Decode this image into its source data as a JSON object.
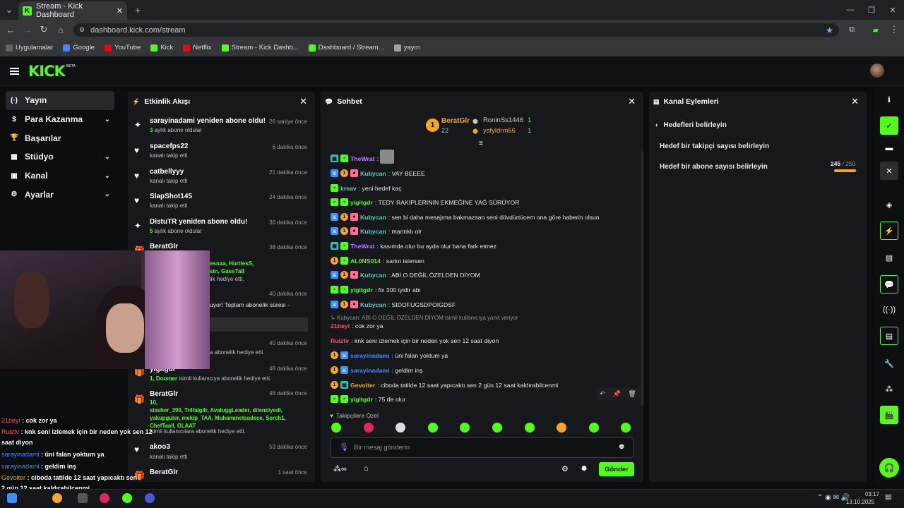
{
  "browser": {
    "tab_title": "Stream - Kick Dashboard",
    "url": "dashboard.kick.com/stream",
    "bookmarks": [
      "Uygulamalar",
      "Google",
      "YouTube",
      "Kick",
      "Netflix",
      "Stream - Kick Dashb...",
      "Dashboard / Stream...",
      "yayın"
    ],
    "bookmark_colors": [
      "#5f6368",
      "#4285f4",
      "#ff0000",
      "#53fc18",
      "#e50914",
      "#53fc18",
      "#53fc18",
      "#9aa0a6"
    ]
  },
  "header": {
    "logo": "KICK",
    "beta": "BETA"
  },
  "nav": {
    "items": [
      {
        "label": "Yayın",
        "icon": "broadcast-icon",
        "active": true,
        "chevron": false
      },
      {
        "label": "Para Kazanma",
        "icon": "money-icon",
        "active": false,
        "chevron": true
      },
      {
        "label": "Başarılar",
        "icon": "trophy-icon",
        "active": false,
        "chevron": false
      },
      {
        "label": "Stüdyo",
        "icon": "studio-icon",
        "active": false,
        "chevron": true
      },
      {
        "label": "Kanal",
        "icon": "channel-icon",
        "active": false,
        "chevron": true
      },
      {
        "label": "Ayarlar",
        "icon": "settings-icon",
        "active": false,
        "chevron": true
      }
    ]
  },
  "activity": {
    "title": "Etkinlik Akışı",
    "items": [
      {
        "name": "sarayinadami yeniden abone oldu!",
        "sub_num": "3",
        "sub": " aylık abone oldular",
        "time": "26 saniye önce",
        "icon": "star-icon"
      },
      {
        "name": "spacefps22",
        "sub_num": "",
        "sub": "kanalı takip etti",
        "time": "6 dakika önce",
        "icon": "heart-icon"
      },
      {
        "name": "catbellyyy",
        "sub_num": "",
        "sub": "kanalı takip etti",
        "time": "21 dakika önce",
        "icon": "heart-icon"
      },
      {
        "name": "SlapShot145",
        "sub_num": "",
        "sub": "kanalı takip etti",
        "time": "24 dakika önce",
        "icon": "heart-icon"
      },
      {
        "name": "DistuTR yeniden abone oldu!",
        "sub_num": "5",
        "sub": " aylık abone oldular",
        "time": "36 dakika önce",
        "icon": "star-icon"
      },
      {
        "name": "BeratGlr",
        "sub_num": "",
        "sub": "",
        "time": "38 dakika önce",
        "icon": "gift-icon"
      }
    ],
    "partial": {
      "gift_names": "esnaa, HurtlesS,",
      "gift_names2": "sin, GassTall",
      "gift_tail": "lik hediye etti.",
      "time_40a": "40 dakika önce",
      "cont": "uyor! Toplam abonelik süresi -",
      "time_40b": "40 dakika önce",
      "gift_tail2": "a abonelik hediye etti.",
      "yigit_name": "yigitgdr",
      "yigit_time": "48 dakika önce",
      "yigit_num": "1, Doomer",
      "yigit_sub": " isimli kullanıcıya abonelik hediye etti."
    },
    "berat2": {
      "name": "BeratGlr",
      "time": "48 dakika önce",
      "num": "10,",
      "list": "slasher_390, Tr4falg4r, AvaluggLeader, dilenciyedi,",
      "list2": "yakupguler, mekip_TAA, Muhammetsadece, Sorch1,",
      "list3": "ChefTaall, GLAAT",
      "sub": " isimli kullanıcılara abonelik hediye etti."
    },
    "akoo": {
      "name": "akoo3",
      "sub": "kanalı takip etti",
      "time": "53 dakika önce"
    },
    "berat3": {
      "name": "BeratGlr",
      "time": "1 saat önce"
    }
  },
  "chat": {
    "title": "Sohbet",
    "leaderboard": {
      "top_name": "BeratGlr",
      "top_rank": "1",
      "top_count": "22",
      "second_name": "RoninSs1446",
      "second_count": "1",
      "third_name": "ysfyldrm56",
      "third_count": "1"
    },
    "messages": [
      {
        "user": "TheWrat",
        "color": "#c777ff",
        "text": ":",
        "badges": [
          "t",
          "g"
        ]
      },
      {
        "user": "Kubycan",
        "color": "#4fd1c5",
        "text": ": VAY BEEEE",
        "badges": [
          "b",
          "o",
          "p"
        ]
      },
      {
        "user": "kreav",
        "color": "#4fd1c5",
        "text": ": yeni hedef kaç",
        "badges": [
          "g"
        ]
      },
      {
        "user": "yigitgdr",
        "color": "#53fc18",
        "text": ": TEDY RAKİPLERİNİN EKMEĞİNE YAĞ SÜRÜYOR",
        "badges": [
          "g",
          "g"
        ]
      },
      {
        "user": "Kubycan",
        "color": "#4fd1c5",
        "text": ": sen bi daha mesajıma bakmazsan seni dövdürtücem ona göre haberin olsun",
        "badges": [
          "b",
          "o",
          "p"
        ]
      },
      {
        "user": "Kubycan",
        "color": "#4fd1c5",
        "text": ": mantıklı olr",
        "badges": [
          "b",
          "o",
          "p"
        ]
      },
      {
        "user": "TheWrat",
        "color": "#c777ff",
        "text": ": kasımda olur bu ayda olur bana fark etmez",
        "badges": [
          "t",
          "g"
        ]
      },
      {
        "user": "AL0NS014",
        "color": "#53fc18",
        "text": ": sarkıt istersen",
        "badges": [
          "o",
          "g"
        ]
      },
      {
        "user": "Kubycan",
        "color": "#4fd1c5",
        "text": ": ABİ O DEĞİL ÖZELDEN DİYOM",
        "badges": [
          "b",
          "o",
          "p"
        ]
      },
      {
        "user": "yigitgdr",
        "color": "#53fc18",
        "text": ": fix 300 iyidir abi",
        "badges": [
          "g",
          "g"
        ]
      },
      {
        "user": "Kubycan",
        "color": "#4fd1c5",
        "text": ": SIDOFUGSDPOIGDSF",
        "badges": [
          "b",
          "o",
          "p"
        ]
      }
    ],
    "reply_context": "↳ Kubycan: ABİ O DEĞİL ÖZELDEN DİYOM isimli kullanıcıya yanıt veriyor",
    "messages2": [
      {
        "user": "21beyi",
        "color": "#ff4d6d",
        "text": ": cok zor ya",
        "badges": []
      },
      {
        "user": "Ruiztv",
        "color": "#ff4d6d",
        "text": ": knk seni izlemek için bir neden yok sen 12 saat diyon",
        "badges": []
      },
      {
        "user": "sarayinadami",
        "color": "#3c8fff",
        "text": ": üni falan yoktum ya",
        "badges": [
          "o",
          "b"
        ]
      },
      {
        "user": "sarayinadami",
        "color": "#3c8fff",
        "text": ": geldim inş",
        "badges": [
          "o",
          "b"
        ]
      },
      {
        "user": "Gevolter",
        "color": "#f5a623",
        "text": ": ciboda tatilde 12 saat yapıcaktı sen 2 gün 12 saat kaldırabilcenmi",
        "badges": [
          "o",
          "t"
        ]
      },
      {
        "user": "yigitgdr",
        "color": "#53fc18",
        "text": ": 75 de olur",
        "badges": [
          "g",
          "g"
        ]
      }
    ],
    "followers_only": "Takipçilere Özel",
    "input_placeholder": "Bir mesaj gönderin",
    "send_label": "Gönder"
  },
  "channel_actions": {
    "title": "Kanal Eylemleri",
    "back_label": "Hedefleri belirleyin",
    "follower_goal": "Hedef bir takipçi sayısı belirleyin",
    "sub_goal": "Hedef bir abone sayısı belirleyin",
    "sub_current": "245",
    "sub_target": " / 250",
    "sub_progress": 0.98
  },
  "overlay": {
    "lines": [
      {
        "user": "21beyi",
        "text": " : cok zor ya",
        "color": "#ff4d6d"
      },
      {
        "user": "Ruiztv",
        "text": " : knk seni izlemek için bir neden yok sen 12",
        "color": "#ff4d6d"
      },
      {
        "user": "",
        "text": "saat diyon",
        "color": "#fff"
      },
      {
        "user": "sarayinadami",
        "text": " : üni falan yoktum ya",
        "color": "#3c8fff"
      },
      {
        "user": "sarayinadami",
        "text": " : geldim inş",
        "color": "#3c8fff"
      },
      {
        "user": "Gevolter",
        "text": " : ciboda tatilde 12 saat yapıcaktı sen",
        "color": "#f5a623"
      },
      {
        "user": "",
        "text": "2 gün 12 saat kaldırabilcenmi",
        "color": "#fff"
      },
      {
        "user": "yigitgdr",
        "text": " : 75 de olur",
        "color": "#53fc18"
      }
    ]
  },
  "taskbar": {
    "time": "03:17",
    "date": "13.10.2025"
  }
}
